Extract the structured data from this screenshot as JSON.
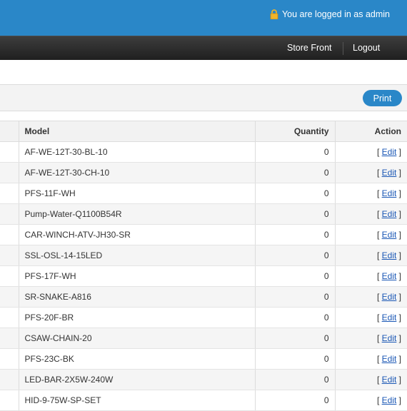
{
  "header": {
    "login_text": "You are logged in as admin",
    "lock_icon": "lock-icon",
    "bar_color": "#2a87c8"
  },
  "nav": {
    "store_front": "Store Front",
    "logout": "Logout"
  },
  "toolbar": {
    "print_label": "Print"
  },
  "table": {
    "columns": {
      "model": "Model",
      "quantity": "Quantity",
      "action": "Action"
    },
    "edit_label": "Edit",
    "rows": [
      {
        "model": "AF-WE-12T-30-BL-10",
        "quantity": "0"
      },
      {
        "model": "AF-WE-12T-30-CH-10",
        "quantity": "0"
      },
      {
        "model": "PFS-11F-WH",
        "quantity": "0"
      },
      {
        "model": "Pump-Water-Q1100B54R",
        "quantity": "0"
      },
      {
        "model": "CAR-WINCH-ATV-JH30-SR",
        "quantity": "0"
      },
      {
        "model": "SSL-OSL-14-15LED",
        "quantity": "0"
      },
      {
        "model": "PFS-17F-WH",
        "quantity": "0"
      },
      {
        "model": "SR-SNAKE-A816",
        "quantity": "0"
      },
      {
        "model": "PFS-20F-BR",
        "quantity": "0"
      },
      {
        "model": "CSAW-CHAIN-20",
        "quantity": "0"
      },
      {
        "model": "PFS-23C-BK",
        "quantity": "0"
      },
      {
        "model": "LED-BAR-2X5W-240W",
        "quantity": "0"
      },
      {
        "model": "HID-9-75W-SP-SET",
        "quantity": "0"
      }
    ]
  }
}
